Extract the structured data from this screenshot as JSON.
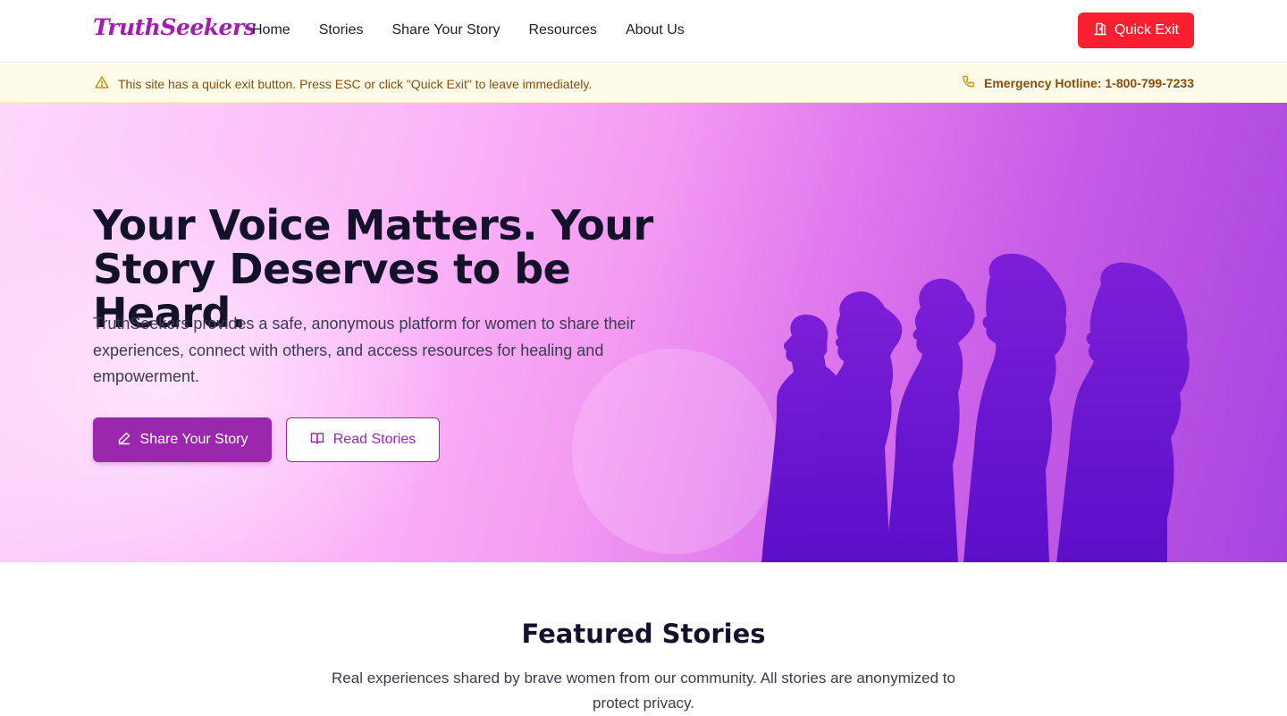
{
  "nav": {
    "logo": "TruthSeekers",
    "links": [
      "Home",
      "Stories",
      "Share Your Story",
      "Resources",
      "About Us"
    ],
    "quick_exit": "Quick Exit"
  },
  "alert": {
    "message": "This site has a quick exit button. Press ESC or click \"Quick Exit\" to leave immediately.",
    "hotline": "Emergency Hotline: 1-800-799-7233"
  },
  "hero": {
    "title": "Your Voice Matters. Your Story Deserves to be Heard.",
    "subtitle": "TruthSeekers provides a safe, anonymous platform for women to share their experiences, connect with others, and access resources for healing and empowerment.",
    "primary_button": "Share Your Story",
    "secondary_button": "Read Stories"
  },
  "featured": {
    "title": "Featured Stories",
    "subtitle": "Real experiences shared by brave women from our community. All stories are anonymized to protect privacy."
  },
  "colors": {
    "brand": "#a21caf",
    "primary_button": "#9b27af",
    "quick_exit": "#fb2030",
    "alert_bg": "#fefce8",
    "alert_text": "#854d0e"
  },
  "icons": {
    "quick_exit": "door-exit-icon",
    "warning": "warning-triangle-icon",
    "hotline": "phone-icon",
    "share": "pencil-icon",
    "read": "open-book-icon"
  }
}
